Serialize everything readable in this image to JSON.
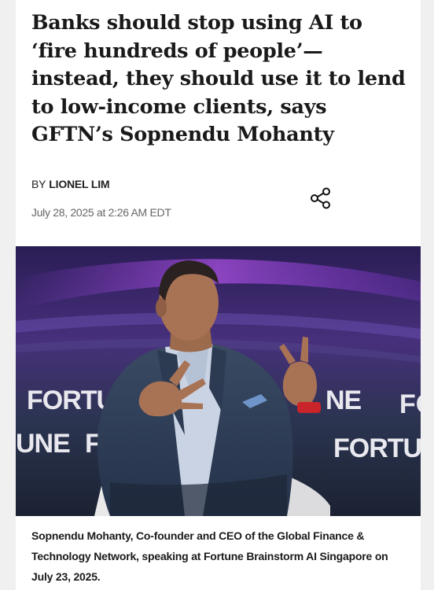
{
  "article": {
    "headline": "Banks should stop using AI to ‘fire hundreds of people’—instead, they should use it to lend to low-income clients, says GFTN’s Sopnendu Mohanty",
    "byline_prefix": "BY",
    "author": "LIONEL LIM",
    "date": "July 28, 2025 at 2:26 AM EDT",
    "share_icon": "share-icon"
  },
  "hero_image": {
    "backdrop_text": [
      "FORTU",
      "UNE",
      "F",
      "NE",
      "FC",
      "FORTUNE"
    ],
    "caption": "Sopnendu Mohanty, Co-founder and CEO of the Global Finance & Technology Network, speaking at Fortune Brainstorm AI Singapore on July 23, 2025."
  }
}
